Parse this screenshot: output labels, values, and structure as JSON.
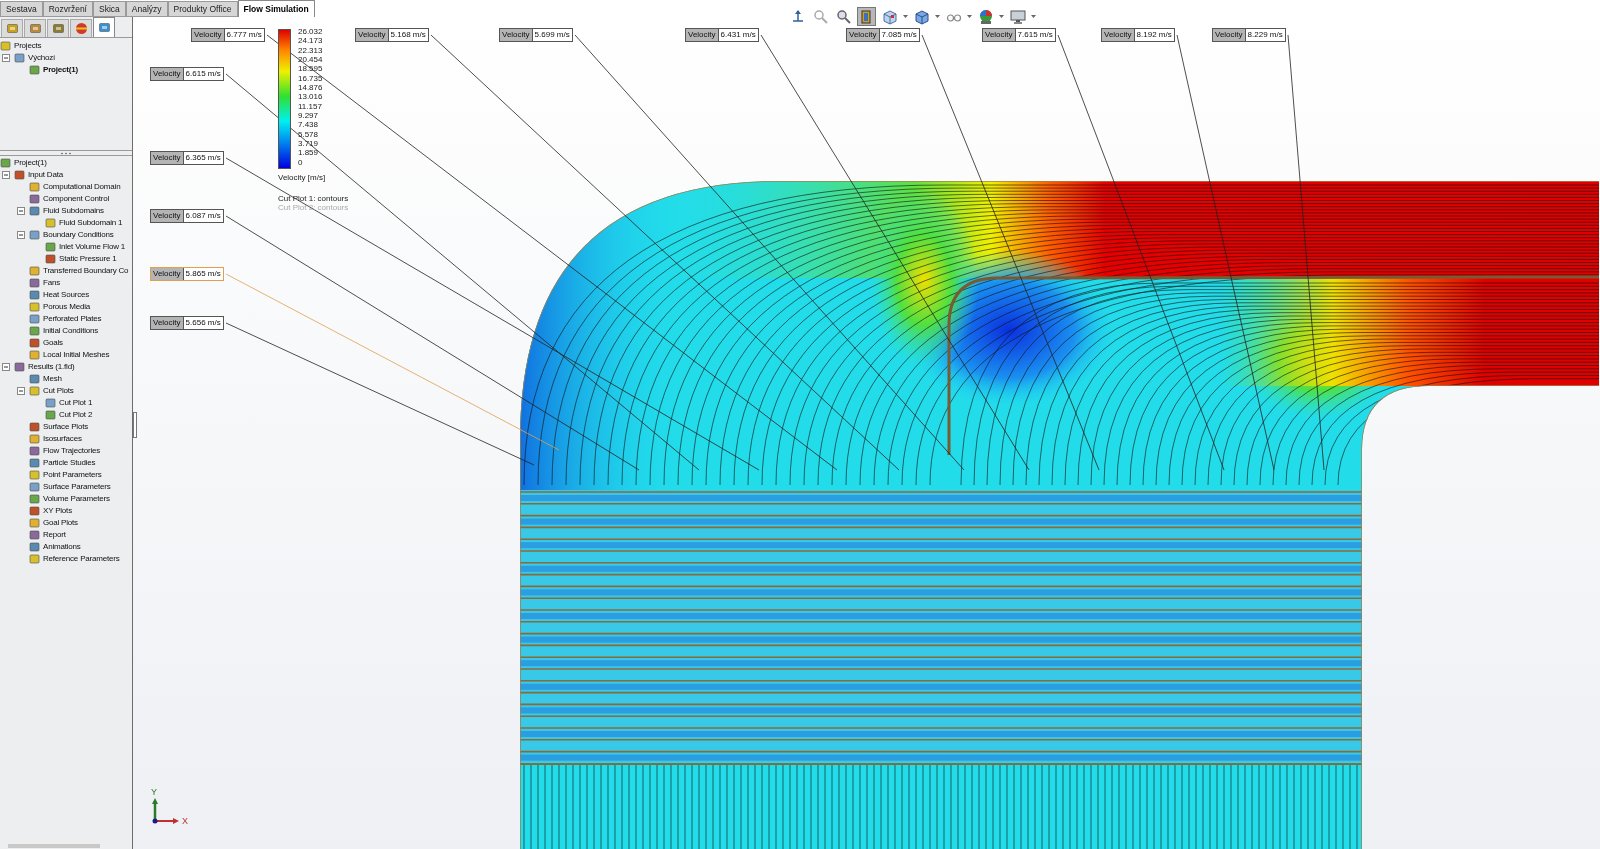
{
  "tabs": [
    {
      "label": "Sestava",
      "selected": false
    },
    {
      "label": "Rozvržení",
      "selected": false
    },
    {
      "label": "Skica",
      "selected": false
    },
    {
      "label": "Analýzy",
      "selected": false
    },
    {
      "label": "Produkty Office",
      "selected": false
    },
    {
      "label": "Flow Simulation",
      "selected": true
    }
  ],
  "panel_tabs": [
    {
      "kind": "features",
      "selected": false
    },
    {
      "kind": "properties",
      "selected": false
    },
    {
      "kind": "configurations",
      "selected": false
    },
    {
      "kind": "appearance",
      "selected": false
    },
    {
      "kind": "flow",
      "selected": true
    }
  ],
  "project_tree": [
    {
      "label": "Projects",
      "active": false,
      "children": [
        {
          "label": "Výchozí",
          "active": false,
          "expanded": true,
          "children": [
            {
              "label": "Project(1)",
              "active": true
            }
          ]
        }
      ]
    }
  ],
  "analysis_tree": [
    {
      "label": "Project(1)",
      "children": [
        {
          "label": "Input Data",
          "expanded": true,
          "children": [
            {
              "label": "Computational Domain"
            },
            {
              "label": "Component Control"
            },
            {
              "label": "Fluid Subdomains",
              "expanded": true,
              "children": [
                {
                  "label": "Fluid Subdomain 1"
                }
              ]
            },
            {
              "label": "Boundary Conditions",
              "expanded": true,
              "children": [
                {
                  "label": "Inlet Volume Flow 1"
                },
                {
                  "label": "Static Pressure 1"
                }
              ]
            },
            {
              "label": "Transferred Boundary Co"
            },
            {
              "label": "Fans"
            },
            {
              "label": "Heat Sources"
            },
            {
              "label": "Porous Media"
            },
            {
              "label": "Perforated Plates"
            },
            {
              "label": "Initial Conditions"
            },
            {
              "label": "Goals"
            },
            {
              "label": "Local Initial Meshes"
            }
          ]
        },
        {
          "label": "Results (1.fld)",
          "expanded": true,
          "children": [
            {
              "label": "Mesh"
            },
            {
              "label": "Cut Plots",
              "expanded": true,
              "children": [
                {
                  "label": "Cut Plot 1"
                },
                {
                  "label": "Cut Plot 2"
                }
              ]
            },
            {
              "label": "Surface Plots"
            },
            {
              "label": "Isosurfaces"
            },
            {
              "label": "Flow Trajectories"
            },
            {
              "label": "Particle Studies"
            },
            {
              "label": "Point Parameters"
            },
            {
              "label": "Surface Parameters"
            },
            {
              "label": "Volume Parameters"
            },
            {
              "label": "XY Plots"
            },
            {
              "label": "Goal Plots"
            },
            {
              "label": "Report"
            },
            {
              "label": "Animations"
            },
            {
              "label": "Reference Parameters"
            }
          ]
        }
      ]
    }
  ],
  "view_toolbar": [
    {
      "kind": "triad",
      "selected": false,
      "dropdown": false
    },
    {
      "kind": "zoom-out",
      "selected": false,
      "dropdown": false
    },
    {
      "kind": "zoom-in",
      "selected": false,
      "dropdown": false
    },
    {
      "kind": "section",
      "selected": true,
      "dropdown": false
    },
    {
      "kind": "view-cube",
      "selected": false,
      "dropdown": true
    },
    {
      "kind": "display-cube",
      "selected": false,
      "dropdown": true
    },
    {
      "kind": "glasses",
      "selected": false,
      "dropdown": true
    },
    {
      "kind": "appearance",
      "selected": false,
      "dropdown": true
    },
    {
      "kind": "monitor",
      "selected": false,
      "dropdown": true
    }
  ],
  "legend": {
    "ticks": [
      "26.032",
      "24.173",
      "22.313",
      "20.454",
      "18.595",
      "16.735",
      "14.876",
      "13.016",
      "11.157",
      "9.297",
      "7.438",
      "5.578",
      "3.719",
      "1.859",
      "0"
    ],
    "title": "Velocity [m/s]",
    "plots": [
      {
        "label": "Cut Plot 1: contours",
        "visible": true
      },
      {
        "label": "Cut Plot 2: contours",
        "visible": false
      }
    ]
  },
  "probes": [
    {
      "label": "Velocity",
      "value": "6.777 m/s",
      "selected": false
    },
    {
      "label": "Velocity",
      "value": "5.168 m/s",
      "selected": false
    },
    {
      "label": "Velocity",
      "value": "5.699 m/s",
      "selected": false
    },
    {
      "label": "Velocity",
      "value": "6.431 m/s",
      "selected": false
    },
    {
      "label": "Velocity",
      "value": "7.085 m/s",
      "selected": false
    },
    {
      "label": "Velocity",
      "value": "7.615 m/s",
      "selected": false
    },
    {
      "label": "Velocity",
      "value": "8.192 m/s",
      "selected": false
    },
    {
      "label": "Velocity",
      "value": "8.229 m/s",
      "selected": false
    },
    {
      "label": "Velocity",
      "value": "6.615 m/s",
      "selected": false
    },
    {
      "label": "Velocity",
      "value": "6.365 m/s",
      "selected": false
    },
    {
      "label": "Velocity",
      "value": "6.087 m/s",
      "selected": false
    },
    {
      "label": "Velocity",
      "value": "5.865 m/s",
      "selected": true
    },
    {
      "label": "Velocity",
      "value": "5.656 m/s",
      "selected": false
    }
  ],
  "triad": {
    "y": "Y",
    "x": "X"
  }
}
